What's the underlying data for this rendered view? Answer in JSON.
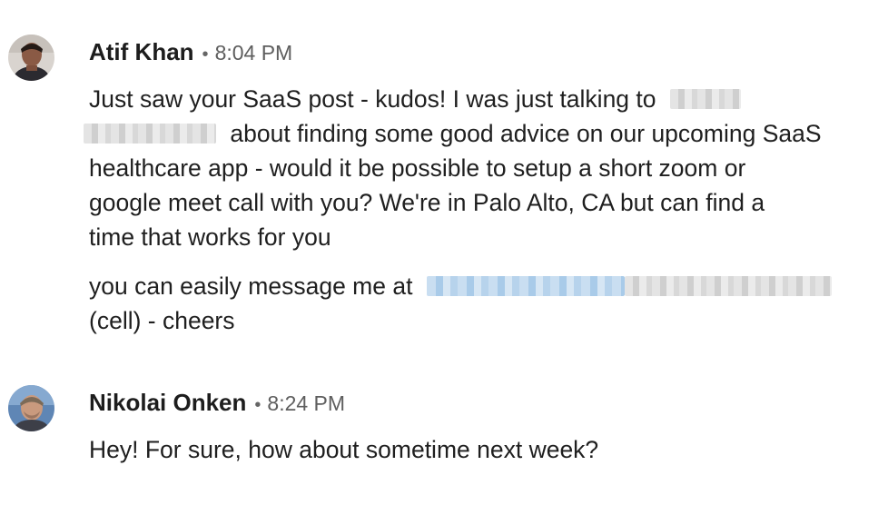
{
  "messages": [
    {
      "sender": "Atif Khan",
      "separator": "•",
      "time": "8:04 PM",
      "avatar_icon": "profile-photo-icon",
      "paragraph1": {
        "line1": "Just saw your SaaS post - kudos! I was just talking to",
        "line2": "about finding some good advice on our upcoming SaaS",
        "line3": "healthcare app - would it be possible to setup a short zoom or",
        "line4": "google meet call with you? We're in Palo Alto, CA but can find a",
        "line5": "time that works for you"
      },
      "paragraph2": {
        "line1": "you can easily message me at",
        "line2": "(cell) - cheers"
      }
    },
    {
      "sender": "Nikolai Onken",
      "separator": "•",
      "time": "8:24 PM",
      "avatar_icon": "profile-photo-icon",
      "text": "Hey! For sure, how about sometime next week?"
    }
  ],
  "colors": {
    "sender_text": "#1d1d1d",
    "time_text": "#5e5e5e",
    "body_text": "#1f1f1f",
    "redaction_gray": "#d8d8d8",
    "redaction_blue": "#b7d3ec"
  }
}
